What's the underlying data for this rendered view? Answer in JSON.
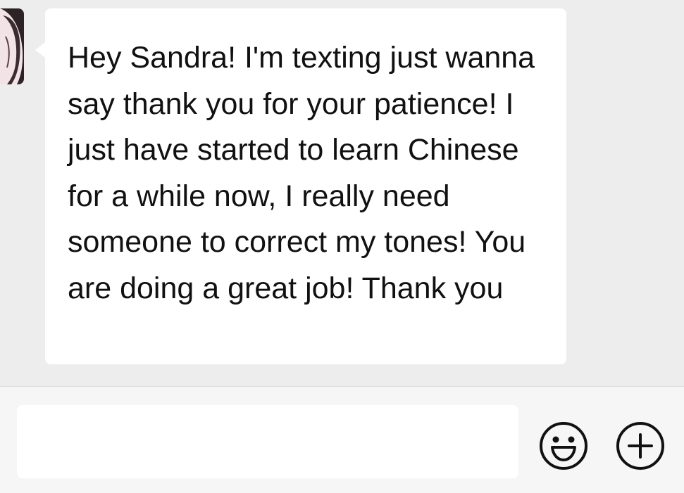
{
  "chat": {
    "messages": [
      {
        "sender": "contact",
        "text": "Hey Sandra! I'm texting just wanna say thank you for your patience! I just have started to learn Chinese for a while now, I really need someone to correct my tones! You are doing a great job! Thank you"
      }
    ]
  },
  "input_bar": {
    "value": "",
    "placeholder": "",
    "icons": [
      "emoji-icon",
      "plus-icon"
    ]
  },
  "colors": {
    "background": "#ededed",
    "bubble": "#ffffff",
    "input_bar": "#f6f6f6",
    "text": "#111111"
  }
}
